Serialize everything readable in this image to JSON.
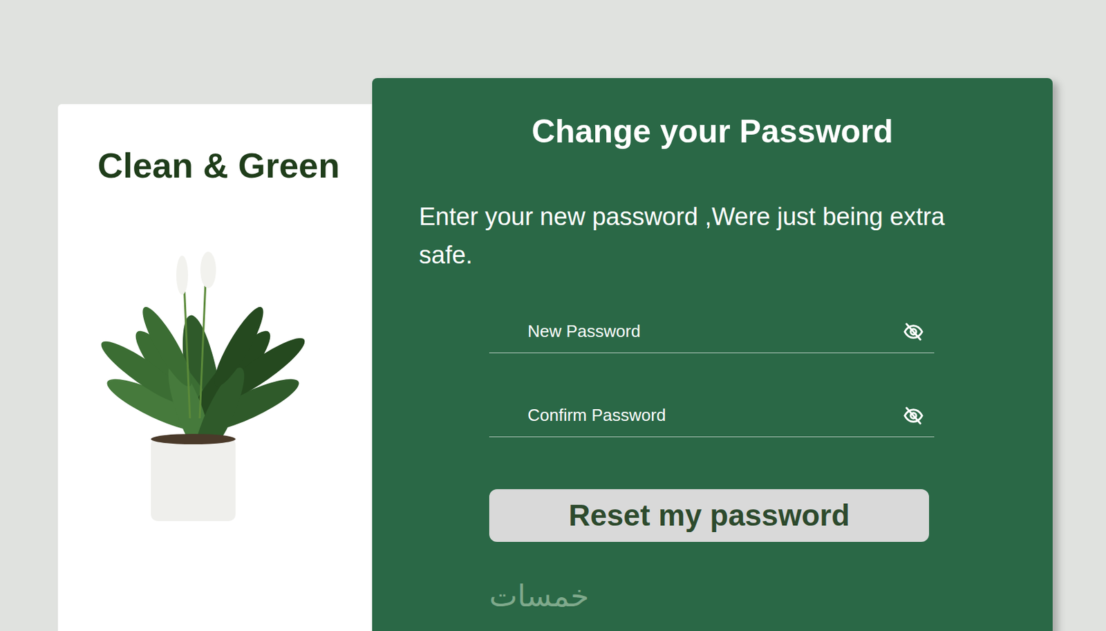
{
  "brand": {
    "name": "Clean & Green"
  },
  "form": {
    "title": "Change your Password",
    "subtitle": "Enter your new password ,Were just being extra safe.",
    "fields": [
      {
        "placeholder": "New Password",
        "visible": false
      },
      {
        "placeholder": "Confirm Password",
        "visible": false
      }
    ],
    "submit": "Reset my password"
  },
  "watermark": "خمسات"
}
